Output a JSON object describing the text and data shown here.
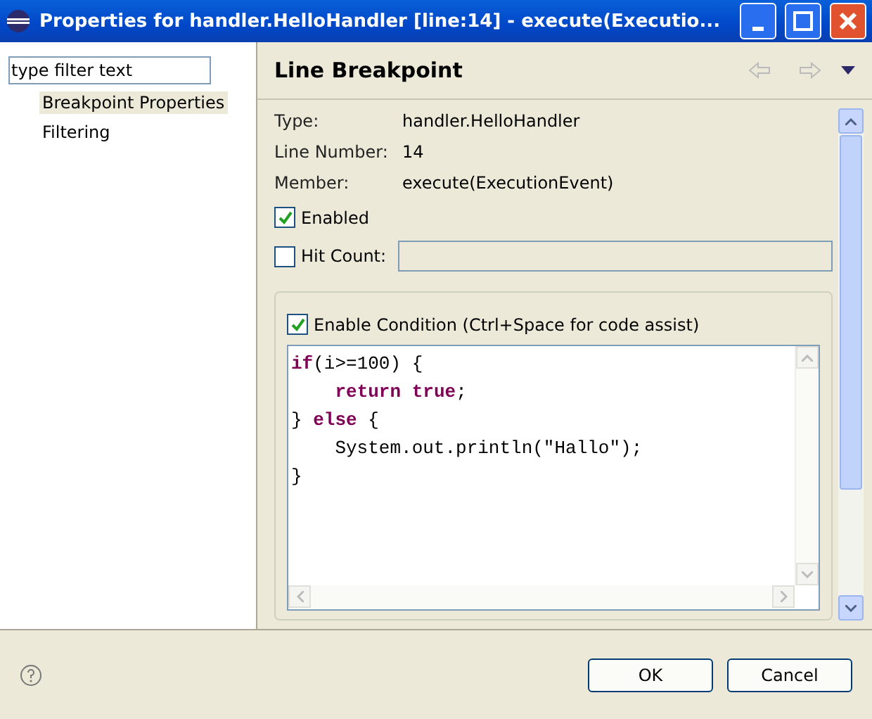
{
  "window": {
    "title": "Properties for handler.HelloHandler [line:14] - execute(Executio..."
  },
  "filter": {
    "value": "type filter text"
  },
  "tree": [
    {
      "label": "Breakpoint Properties",
      "selected": true
    },
    {
      "label": "Filtering",
      "selected": false
    }
  ],
  "page": {
    "title": "Line Breakpoint"
  },
  "fields": [
    {
      "label": "Type:",
      "value": "handler.HelloHandler"
    },
    {
      "label": "Line Number:",
      "value": "14"
    },
    {
      "label": "Member:",
      "value": "execute(ExecutionEvent)"
    }
  ],
  "enabled": {
    "label": "Enabled",
    "checked": true
  },
  "hit_count": {
    "label": "Hit Count:",
    "checked": false
  },
  "condition": {
    "label": "Enable Condition (Ctrl+Space for code assist)",
    "checked": true,
    "code": [
      "**if**(i>=100) {",
      "    **return** **true**;",
      "} **else** {",
      "    System.out.println(\"Hallo\");",
      "}"
    ]
  },
  "buttons": [
    "OK",
    "Cancel"
  ]
}
